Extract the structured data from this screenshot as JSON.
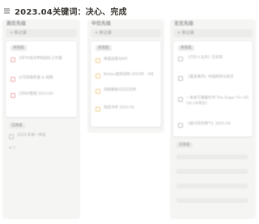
{
  "page": {
    "title": "2023.04关键词：决心、完成",
    "menu_icon": "list-icon"
  },
  "columns": [
    {
      "name": "高优先级",
      "new_label": "+ 新记录",
      "group_label": "未完成",
      "items": [
        "3月TR成功率和团队工作量",
        "公司周报检查 & 排期",
        "2月KR整理 2023.04"
      ],
      "done_label": "已完成",
      "done_items": [
        "2023 年第一季度"
      ],
      "count_label": "≡ 1"
    },
    {
      "name": "中优先级",
      "new_label": "+ 新记录",
      "group_label": "未完成",
      "items": [
        "季度团建与KPI",
        "Notion使用说明 2023年 · 4月",
        "周报模板与日历同步",
        "完成书单 2023.04"
      ]
    },
    {
      "name": "无优先级",
      "new_label": "+ 新记录",
      "group_label": "未完成",
      "items": [
        "《万历十五年》已读完",
        "《置身事内》中国政府与经济",
        "一本关于健康的书 The Sugar Fix (2019) (中英文)",
        "《被讨厌的勇气》2023.04"
      ],
      "done_label": "已完成",
      "done_count": 4
    }
  ],
  "colors": {
    "board_bg": "#f5f5f4",
    "high": "#eda7a7",
    "mid": "#f0cd8b",
    "none": "#c7c7c7"
  }
}
